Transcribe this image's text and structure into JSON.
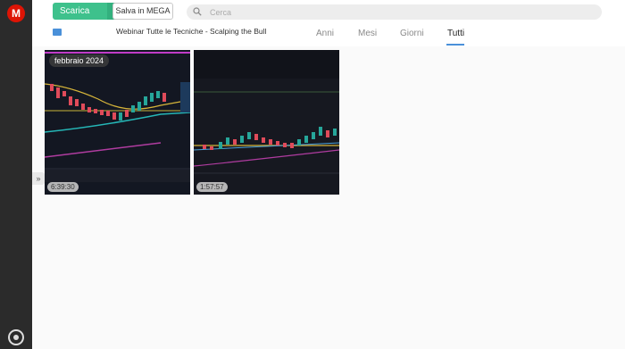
{
  "app": {
    "logo_letter": "M"
  },
  "toolbar": {
    "download_label": "Scarica",
    "download_caret": "⌄",
    "save_label": "Salva in MEGA",
    "search_placeholder": "Cerca"
  },
  "breadcrumb": {
    "title": "Webinar Tutte le Tecniche - Scalping the Bull"
  },
  "tabs": [
    {
      "label": "Anni"
    },
    {
      "label": "Mesi"
    },
    {
      "label": "Giorni"
    },
    {
      "label": "Tutti"
    }
  ],
  "grid": {
    "date_badge": "febbraio 2024",
    "items": [
      {
        "duration": "6:39:30"
      },
      {
        "duration": "1:57:57"
      }
    ]
  },
  "colors": {
    "accent_green": "#3ec18c",
    "brand_red": "#dd1405",
    "tab_active": "#4a90d9"
  }
}
